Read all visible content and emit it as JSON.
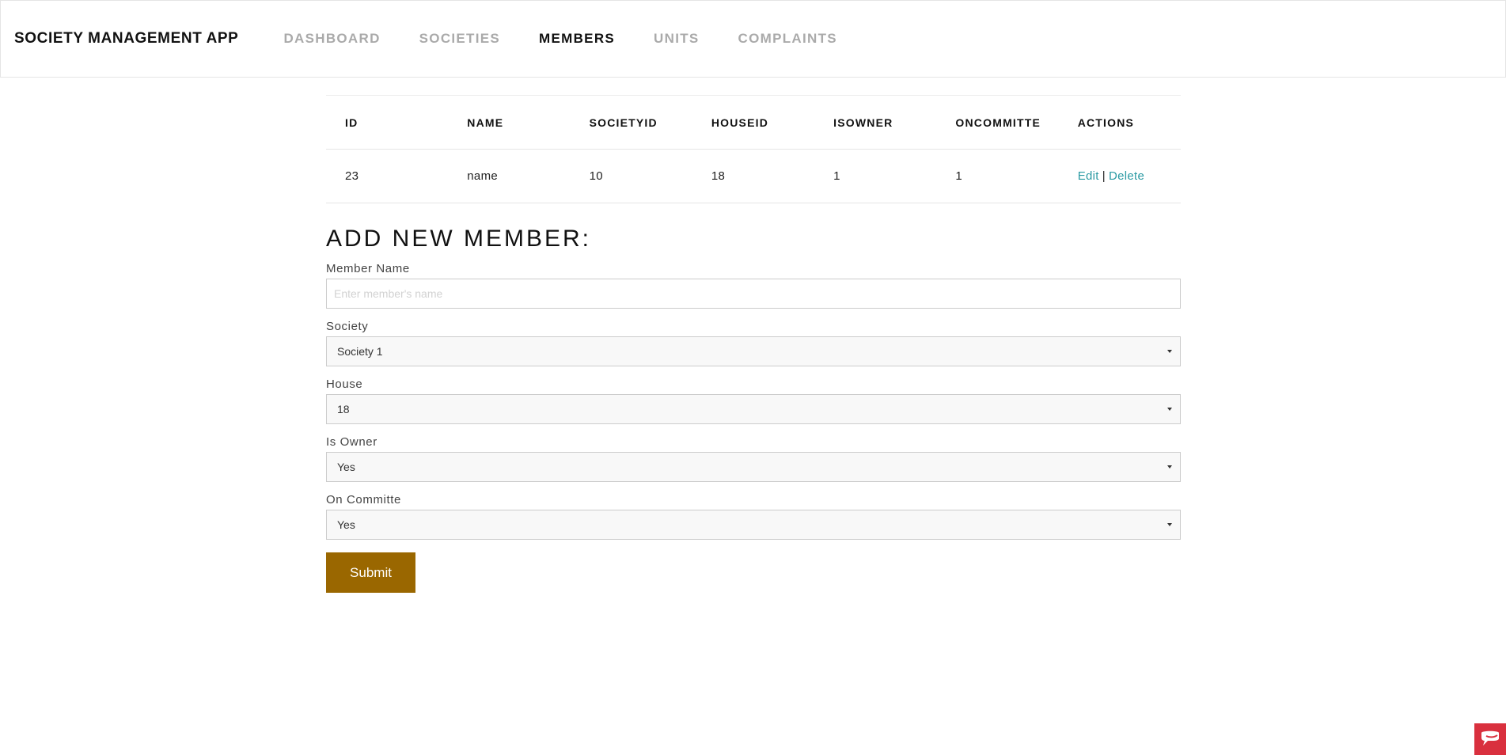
{
  "app": {
    "brand": "SOCIETY MANAGEMENT APP"
  },
  "nav": {
    "items": [
      {
        "label": "DASHBOARD",
        "active": false
      },
      {
        "label": "SOCIETIES",
        "active": false
      },
      {
        "label": "MEMBERS",
        "active": true
      },
      {
        "label": "UNITS",
        "active": false
      },
      {
        "label": "COMPLAINTS",
        "active": false
      }
    ]
  },
  "table": {
    "headers": [
      "ID",
      "NAME",
      "SOCIETYID",
      "HOUSEID",
      "ISOWNER",
      "ONCOMMITTE",
      "ACTIONS"
    ],
    "rows": [
      {
        "id": "23",
        "name": "name",
        "societyid": "10",
        "houseid": "18",
        "isowner": "1",
        "oncommitte": "1",
        "edit": "Edit",
        "separator": "|",
        "delete": "Delete"
      }
    ]
  },
  "form": {
    "title": "ADD NEW MEMBER:",
    "member_name": {
      "label": "Member Name",
      "placeholder": "Enter member's name",
      "value": ""
    },
    "society": {
      "label": "Society",
      "value": "Society 1"
    },
    "house": {
      "label": "House",
      "value": "18"
    },
    "is_owner": {
      "label": "Is Owner",
      "value": "Yes"
    },
    "on_committe": {
      "label": "On Committe",
      "value": "Yes"
    },
    "submit_label": "Submit"
  },
  "colors": {
    "accent_link": "#2b9aa3",
    "submit_bg": "#9a6700",
    "widget_bg": "#d9303e"
  }
}
